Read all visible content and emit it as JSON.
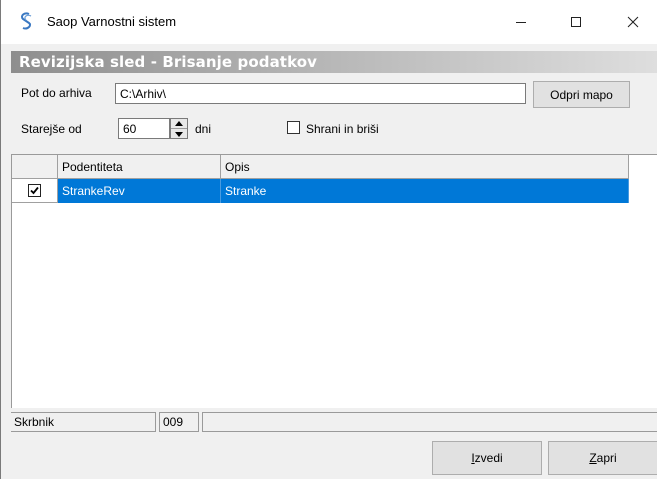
{
  "window": {
    "title": "Saop Varnostni sistem",
    "controls": {
      "minimize": "–",
      "maximize": "☐",
      "close": "✕"
    },
    "icon": "saop-logo-icon"
  },
  "banner": {
    "title": "Revizijska sled - Brisanje podatkov"
  },
  "form": {
    "path_label": "Pot do arhiva",
    "path_value": "C:\\Arhiv\\",
    "open_folder_button": "Odpri mapo",
    "older_than_label": "Starejše od",
    "older_than_value": "60",
    "days_label": "dni",
    "save_and_delete": {
      "label": "Shrani in briši",
      "checked": false
    }
  },
  "grid": {
    "columns": [
      "",
      "Podentiteta",
      "Opis"
    ],
    "rows": [
      {
        "checked": true,
        "podentiteta": "StrankeRev",
        "opis": "Stranke",
        "selected": true
      }
    ]
  },
  "status": {
    "user": "Skrbnik",
    "code": "009",
    "message": ""
  },
  "actions": {
    "execute": {
      "prefix": "",
      "hotkey": "I",
      "rest": "zvedi"
    },
    "close": {
      "prefix": "",
      "hotkey": "Z",
      "rest": "apri"
    }
  },
  "colors": {
    "selection": "#0078d7",
    "banner_start": "#8e8e8e",
    "banner_end": "#dedede",
    "icon_accent": "#3a78c2"
  }
}
